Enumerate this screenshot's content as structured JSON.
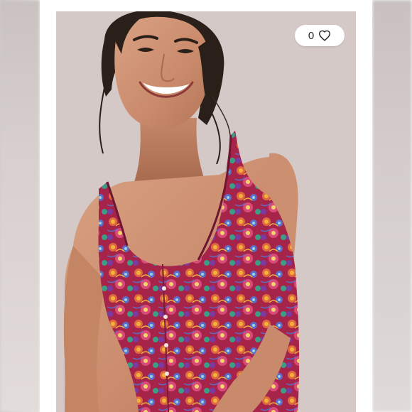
{
  "like_button": {
    "count": "0",
    "icon": "heart-outline-icon"
  },
  "photo": {
    "subject": "model-wearing-printed-sleeveless-dress"
  },
  "colors": {
    "background": "#ffffff",
    "backdrop": "#d8cdcb",
    "dress_primary": "#b0284f",
    "dress_accent_1": "#e06a3f",
    "dress_accent_2": "#5a6ec8",
    "dress_accent_3": "#f1b23a"
  }
}
